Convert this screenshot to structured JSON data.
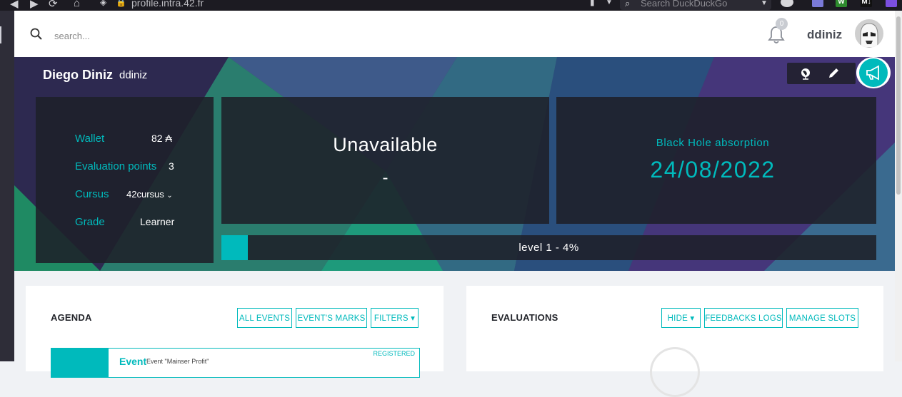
{
  "browser": {
    "url": "profile.intra.42.fr",
    "search_placeholder": "Search DuckDuckGo"
  },
  "header": {
    "search_placeholder": "search...",
    "notification_count": "0",
    "username": "ddiniz"
  },
  "profile": {
    "full_name": "Diego Diniz",
    "login": "ddiniz",
    "info": [
      {
        "label": "Wallet",
        "value": "82 ₳"
      },
      {
        "label": "Evaluation points",
        "value": "3"
      },
      {
        "label": "Cursus",
        "value": "42cursus"
      },
      {
        "label": "Grade",
        "value": "Learner"
      }
    ],
    "status": {
      "title": "Unavailable",
      "subtitle": "-"
    },
    "black_hole": {
      "label": "Black Hole absorption",
      "date": "24/08/2022"
    },
    "level": {
      "text": "level 1 - 4%",
      "progress_fraction": 0.04
    },
    "accent_color": "#00babc"
  },
  "agenda": {
    "heading": "AGENDA",
    "buttons": [
      "ALL EVENTS",
      "EVENT'S MARKS",
      "FILTERS ▾"
    ],
    "event": {
      "title": "Event",
      "description": "Event \"Mainser Profit\"",
      "badge": "REGISTERED"
    }
  },
  "evaluations": {
    "heading": "EVALUATIONS",
    "buttons": [
      "HIDE ▾",
      "FEEDBACKS LOGS",
      "MANAGE SLOTS"
    ]
  }
}
